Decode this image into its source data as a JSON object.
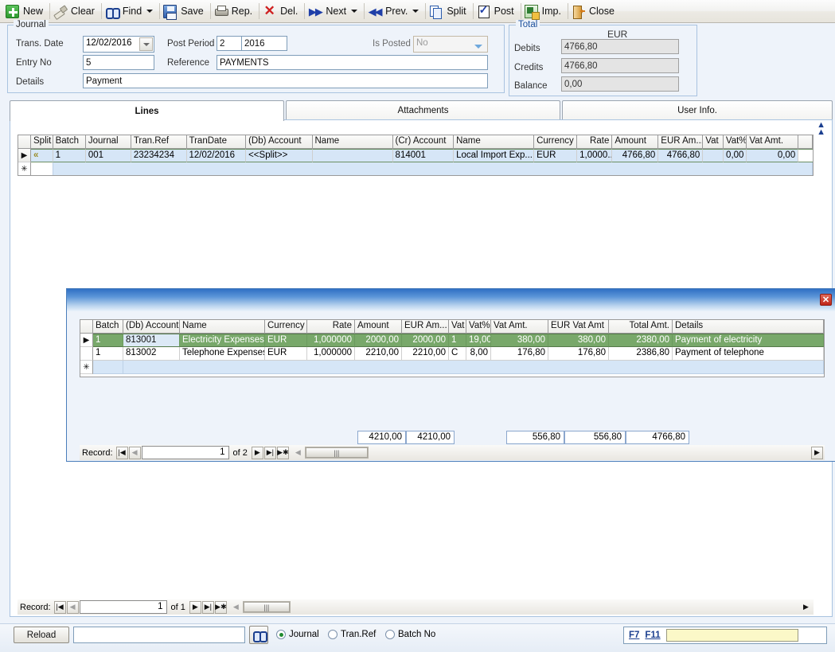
{
  "toolbar": {
    "items": [
      {
        "label": "New",
        "icon": "plus-icon"
      },
      {
        "label": "Clear",
        "icon": "eraser-icon"
      },
      {
        "label": "Find",
        "icon": "binoculars-icon",
        "dropdown": true
      },
      {
        "label": "Save",
        "icon": "floppy-disk-icon"
      },
      {
        "label": "Rep.",
        "icon": "printer-icon"
      },
      {
        "label": "Del.",
        "icon": "red-x-icon"
      },
      {
        "label": "Next",
        "icon": "fast-forward-icon",
        "dropdown": true
      },
      {
        "label": "Prev.",
        "icon": "rewind-icon",
        "dropdown": true
      },
      {
        "label": "Split",
        "icon": "copy-icon"
      },
      {
        "label": "Post",
        "icon": "checklist-icon"
      },
      {
        "label": "Imp.",
        "icon": "excel-import-icon"
      },
      {
        "label": "Close",
        "icon": "exit-door-icon"
      }
    ]
  },
  "journal": {
    "legend": "Journal",
    "trans_date_label": "Trans. Date",
    "trans_date_value": "12/02/2016",
    "entry_no_label": "Entry No",
    "entry_no_value": "5",
    "details_label": "Details",
    "details_value": "Payment",
    "post_period_label": "Post Period",
    "post_period_value": "2",
    "post_year_value": "2016",
    "reference_label": "Reference",
    "reference_value": "PAYMENTS",
    "is_posted_label": "Is Posted",
    "is_posted_value": "No"
  },
  "total": {
    "legend": "Total",
    "currency": "EUR",
    "debits_label": "Debits",
    "debits_value": "4766,80",
    "credits_label": "Credits",
    "credits_value": "4766,80",
    "balance_label": "Balance",
    "balance_value": "0,00"
  },
  "tabs": [
    {
      "label": "Lines",
      "active": true
    },
    {
      "label": "Attachments",
      "active": false
    },
    {
      "label": "User Info.",
      "active": false
    }
  ],
  "lines_grid": {
    "columns": [
      "Split",
      "Batch",
      "Journal",
      "Tran.Ref",
      "TranDate",
      "(Db) Account",
      "Name",
      "(Cr) Account",
      "Name",
      "Currency",
      "Rate",
      "Amount",
      "EUR Am...",
      "Vat",
      "Vat%",
      "Vat Amt."
    ],
    "row": {
      "split": "«",
      "batch": "1",
      "journal": "001",
      "tran_ref": "23234234",
      "tran_date": "12/02/2016",
      "db_account": "<<Split>>",
      "db_name": "",
      "cr_account": "814001",
      "cr_name": "Local Import Exp...",
      "currency": "EUR",
      "rate": "1,0000...",
      "amount": "4766,80",
      "eur_amount": "4766,80",
      "vat": "",
      "vat_pct": "0,00",
      "vat_amount": "0,00"
    },
    "new_row_marker": "✳",
    "scroll_up_icon": "scroll-up-icon"
  },
  "split_grid": {
    "columns": [
      "Batch",
      "(Db) Account",
      "Name",
      "Currency",
      "Rate",
      "Amount",
      "EUR Am...",
      "Vat",
      "Vat%",
      "Vat Amt.",
      "EUR Vat Amt",
      "Total Amt.",
      "Details"
    ],
    "rows": [
      {
        "batch": "1",
        "db_account": "813001",
        "name": "Electricity Expenses",
        "currency": "EUR",
        "rate": "1,000000",
        "amount": "2000,00",
        "eur_amount": "2000,00",
        "vat": "1",
        "vat_pct": "19,00",
        "vat_amount": "380,00",
        "eur_vat_amount": "380,00",
        "total_amount": "2380,00",
        "details": "Payment of electricity",
        "selected": true
      },
      {
        "batch": "1",
        "db_account": "813002",
        "name": "Telephone Expenses",
        "currency": "EUR",
        "rate": "1,000000",
        "amount": "2210,00",
        "eur_amount": "2210,00",
        "vat": "C",
        "vat_pct": "8,00",
        "vat_amount": "176,80",
        "eur_vat_amount": "176,80",
        "total_amount": "2386,80",
        "details": "Payment of telephone",
        "selected": false
      }
    ],
    "new_row_marker": "✳",
    "totals": {
      "amount": "4210,00",
      "eur_amount": "4210,00",
      "vat_amount": "556,80",
      "eur_vat_amount": "556,80",
      "total_amount": "4766,80"
    },
    "record_nav": {
      "label": "Record:",
      "current": "1",
      "of_label": "of 2"
    },
    "close_icon": "close-icon"
  },
  "lines_record_nav": {
    "label": "Record:",
    "current": "1",
    "of_label": "of 1"
  },
  "bottom": {
    "reload_label": "Reload",
    "search_value": "",
    "search_icon": "binoculars-icon",
    "radios": [
      {
        "label": "Journal",
        "selected": true
      },
      {
        "label": "Tran.Ref",
        "selected": false
      },
      {
        "label": "Batch No",
        "selected": false
      }
    ],
    "f7_label": "F7",
    "f11_label": "F11",
    "f_input_value": ""
  },
  "colors": {
    "selected_row_green": "#78a86a",
    "selected_row_blue": "#d6e6f7",
    "accent_blue": "#2f6fc4",
    "highlight_yellow": "#fbf8c8"
  }
}
